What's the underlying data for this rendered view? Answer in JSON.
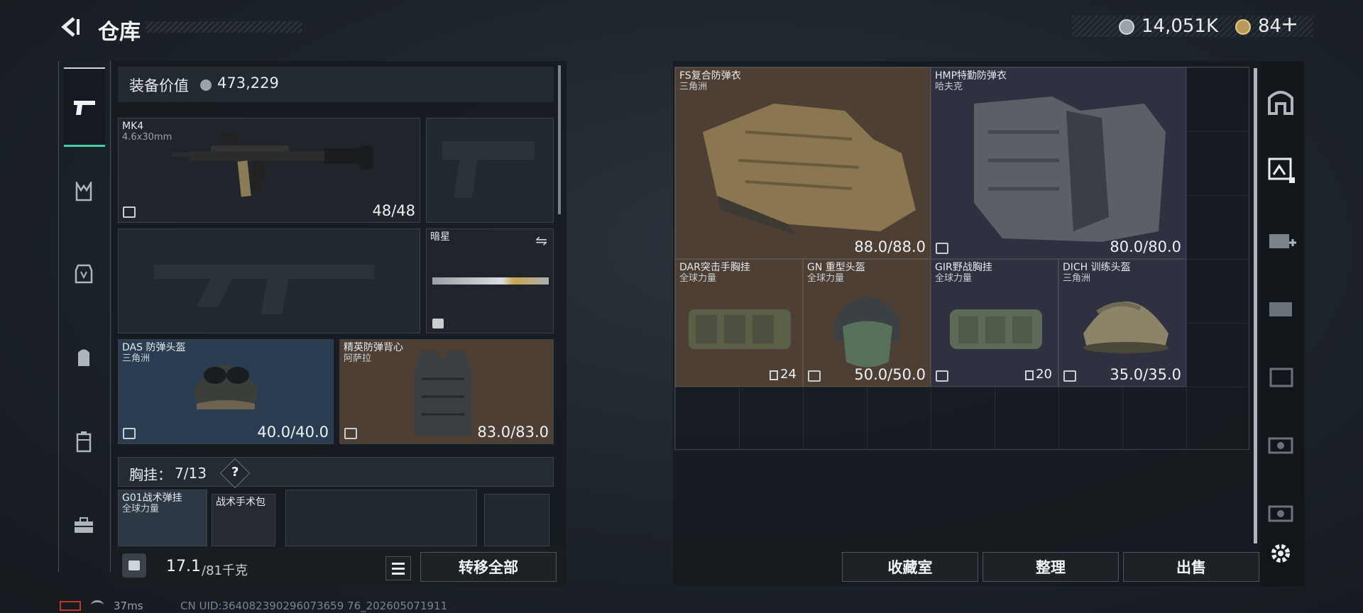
{
  "header": {
    "title": "仓库",
    "currency_value": "14,051K",
    "tokens_value": "84"
  },
  "loadout": {
    "equip_value_label": "装备价值",
    "equip_value": "473,229",
    "primary": {
      "name": "MK4",
      "caliber": "4.6x30mm",
      "ammo": "48/48"
    },
    "melee": {
      "name": "暗星"
    },
    "helmet": {
      "name": "DAS 防弹头盔",
      "origin": "三角洲",
      "durability": "40.0/40.0"
    },
    "armor": {
      "name": "精英防弹背心",
      "origin": "阿萨拉",
      "durability": "83.0/83.0"
    },
    "rig_label": "胸挂：",
    "rig_count": "7/13",
    "rig_help": "?",
    "rig_items": [
      {
        "name": "G01战术弹挂",
        "origin": "全球力量"
      },
      {
        "name": "战术手术包"
      }
    ],
    "weight_current": "17.1",
    "weight_capacity": "/81千克",
    "transfer_all": "转移全部"
  },
  "storage": {
    "items": [
      {
        "name": "FS复合防弹衣",
        "origin": "三角洲",
        "durability": "88.0/88.0"
      },
      {
        "name": "HMP特勤防弹衣",
        "origin": "哈夫克",
        "durability": "80.0/80.0"
      },
      {
        "name": "DAR突击手胸挂",
        "origin": "全球力量",
        "count": "24"
      },
      {
        "name": "GN 重型头盔",
        "origin": "全球力量",
        "durability": "50.0/50.0"
      },
      {
        "name": "GIR野战胸挂",
        "origin": "全球力量",
        "count": "20"
      },
      {
        "name": "DICH 训练头盔",
        "origin": "三角洲",
        "durability": "35.0/35.0"
      }
    ],
    "buttons": {
      "collection": "收藏室",
      "organize": "整理",
      "sell": "出售"
    }
  },
  "status": {
    "ping": "37ms",
    "uid": "CN UID:364082390296073659 76_202605071911"
  },
  "colors": {
    "selected": "#3fd0a0",
    "brown_slot": "#4d3f34",
    "blue_slot": "#2a3d50",
    "purple_slot": "#2f3040"
  }
}
